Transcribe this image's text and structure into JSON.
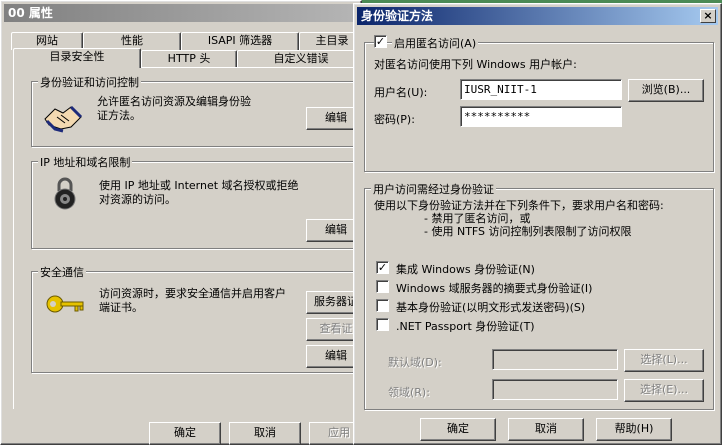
{
  "props_window": {
    "title": "00 属性",
    "tabs_back": [
      "网站",
      "性能",
      "ISAPI 筛选器",
      "主目录"
    ],
    "tabs_front": [
      "目录安全性",
      "HTTP 头",
      "自定义错误"
    ],
    "auth_group": {
      "label": "身份验证和访问控制",
      "text": "允许匿名访问资源及编辑身份验证方法。",
      "edit_btn": "编辑"
    },
    "ip_group": {
      "label": "IP 地址和域名限制",
      "text": "使用 IP 地址或 Internet 域名授权或拒绝对资源的访问。",
      "edit_btn": "编辑"
    },
    "secure_group": {
      "label": "安全通信",
      "text": "访问资源时，要求安全通信并启用客户端证书。",
      "server_cert_btn": "服务器证",
      "view_cert_btn": "查看证",
      "edit_btn": "编辑"
    },
    "ok_btn": "确定",
    "cancel_btn": "取消",
    "apply_btn": "应用"
  },
  "auth_dialog": {
    "title": "身份验证方法",
    "anon": {
      "checkbox_label": "启用匿名访问(A)",
      "checked": true,
      "desc": "对匿名访问使用下列 Windows 用户帐户:",
      "username_label": "用户名(U):",
      "username_value": "IUSR_NIIT-1",
      "browse_btn": "浏览(B)...",
      "password_label": "密码(P):",
      "password_value": "**********"
    },
    "auth_group": {
      "label": "用户访问需经过身份验证",
      "desc1": "使用以下身份验证方法并在下列条件下，要求用户名和密码:",
      "cond1": "- 禁用了匿名访问，或",
      "cond2": "- 使用 NTFS 访问控制列表限制了访问权限",
      "options": [
        {
          "label": "集成 Windows 身份验证(N)",
          "checked": true
        },
        {
          "label": "Windows 域服务器的摘要式身份验证(I)",
          "checked": false
        },
        {
          "label": "基本身份验证(以明文形式发送密码)(S)",
          "checked": false
        },
        {
          "label": ".NET Passport 身份验证(T)",
          "checked": false
        }
      ],
      "default_domain_label": "默认域(D):",
      "realm_label": "领域(R):",
      "select_btn_1": "选择(L)...",
      "select_btn_2": "选择(E)..."
    },
    "ok_btn": "确定",
    "cancel_btn": "取消",
    "help_btn": "帮助(H)",
    "close_glyph": "×"
  }
}
